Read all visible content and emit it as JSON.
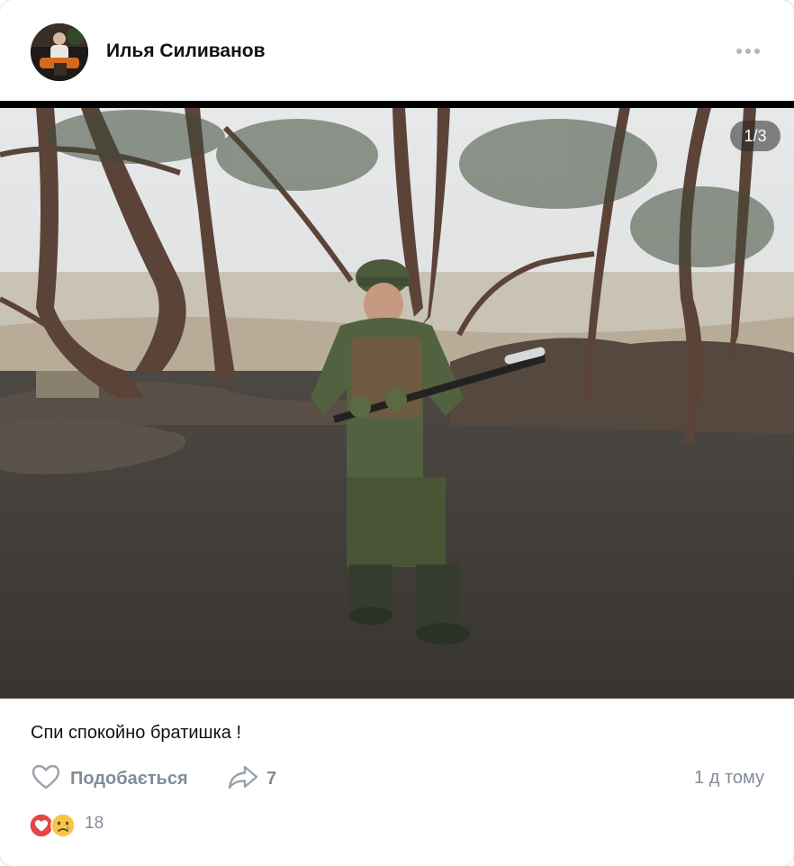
{
  "post": {
    "author": "Илья Силиванов",
    "caption": "Спи спокойно братишка !",
    "photo_counter": "1/3",
    "like_label": "Подобається",
    "share_count": "7",
    "time": "1 д тому",
    "reactions_count": "18"
  },
  "icons": {
    "more": "more-horizontal-icon",
    "like": "heart-outline-icon",
    "share": "share-arrow-icon",
    "reactions": [
      "heart-reaction-icon",
      "crying-face-reaction-icon"
    ]
  },
  "colors": {
    "secondary_text": "#818c99",
    "reaction_heart": "#e64646",
    "reaction_face": "#f7c548"
  }
}
